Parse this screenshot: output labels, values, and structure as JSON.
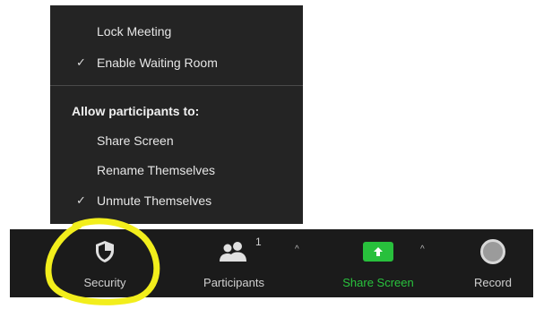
{
  "security_menu": {
    "items": [
      {
        "label": "Lock Meeting",
        "checked": false
      },
      {
        "label": "Enable Waiting Room",
        "checked": true
      }
    ],
    "section_heading": "Allow participants to:",
    "permissions": [
      {
        "label": "Share Screen",
        "checked": false
      },
      {
        "label": "Rename Themselves",
        "checked": false
      },
      {
        "label": "Unmute Themselves",
        "checked": true
      }
    ],
    "check_glyph": "✓"
  },
  "toolbar": {
    "security_label": "Security",
    "participants_label": "Participants",
    "participants_count": "1",
    "share_screen_label": "Share Screen",
    "record_label": "Record",
    "caret_glyph": "^"
  },
  "colors": {
    "menu_background": "#242424",
    "toolbar_background": "#1b1b1b",
    "share_green": "#28c03c",
    "highlight_yellow": "#f2ee1c"
  },
  "icons": {
    "security": "shield-icon",
    "participants": "participants-icon",
    "share_screen": "share-screen-icon",
    "record": "record-icon"
  }
}
